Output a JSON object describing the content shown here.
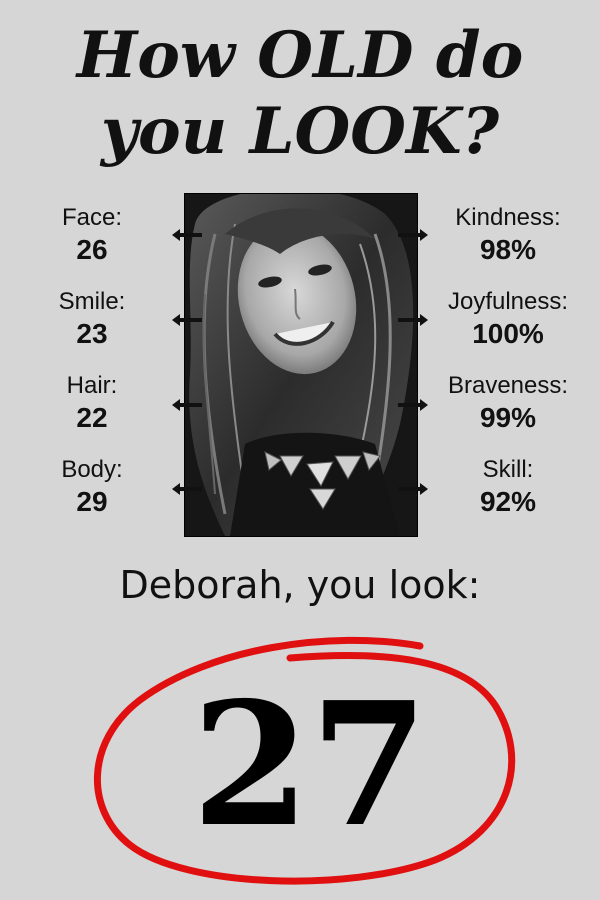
{
  "title": {
    "line1": "How OLD do",
    "line2": "you LOOK?"
  },
  "left_stats": [
    {
      "label": "Face:",
      "value": "26"
    },
    {
      "label": "Smile:",
      "value": "23"
    },
    {
      "label": "Hair:",
      "value": "22"
    },
    {
      "label": "Body:",
      "value": "29"
    }
  ],
  "right_stats": [
    {
      "label": "Kindness:",
      "value": "98%"
    },
    {
      "label": "Joyfulness:",
      "value": "100%"
    },
    {
      "label": "Braveness:",
      "value": "99%"
    },
    {
      "label": "Skill:",
      "value": "92%"
    }
  ],
  "result": {
    "text": "Deborah, you look:",
    "age": "27",
    "circle_color": "#e01010"
  },
  "colors": {
    "background": "#d6d6d6",
    "text": "#111111"
  }
}
